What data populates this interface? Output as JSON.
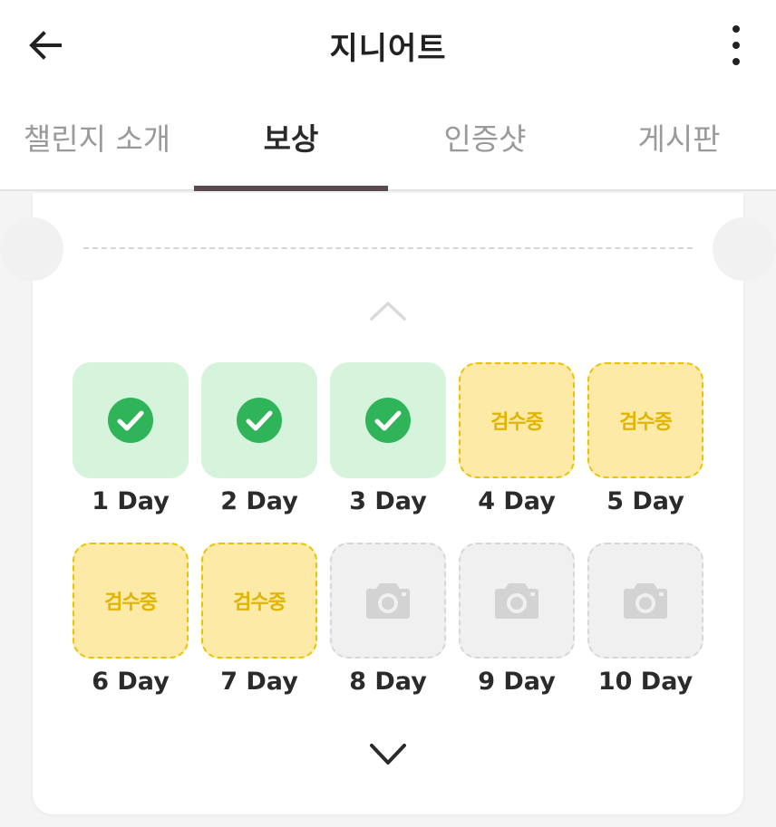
{
  "header": {
    "title": "지니어트",
    "back_icon": "arrow-left-icon",
    "more_icon": "more-vertical-icon"
  },
  "tabs": [
    {
      "label": "챌린지 소개",
      "active": false
    },
    {
      "label": "보상",
      "active": true
    },
    {
      "label": "인증샷",
      "active": false
    },
    {
      "label": "게시판",
      "active": false
    }
  ],
  "colors": {
    "tab_indicator": "#5a4a4f",
    "done_bg": "#d6f3dc",
    "done_check": "#2fb45a",
    "review_bg": "#fdeaa6",
    "review_text": "#e2b400",
    "empty_bg": "#f0f0f0",
    "camera": "#d3d3d3"
  },
  "days": [
    {
      "label": "1 Day",
      "status": "done",
      "text": ""
    },
    {
      "label": "2 Day",
      "status": "done",
      "text": ""
    },
    {
      "label": "3 Day",
      "status": "done",
      "text": ""
    },
    {
      "label": "4 Day",
      "status": "review",
      "text": "검수중"
    },
    {
      "label": "5 Day",
      "status": "review",
      "text": "검수중"
    },
    {
      "label": "6 Day",
      "status": "review",
      "text": "검수중"
    },
    {
      "label": "7 Day",
      "status": "review",
      "text": "검수중"
    },
    {
      "label": "8 Day",
      "status": "empty",
      "text": ""
    },
    {
      "label": "9 Day",
      "status": "empty",
      "text": ""
    },
    {
      "label": "10 Day",
      "status": "empty",
      "text": ""
    }
  ]
}
